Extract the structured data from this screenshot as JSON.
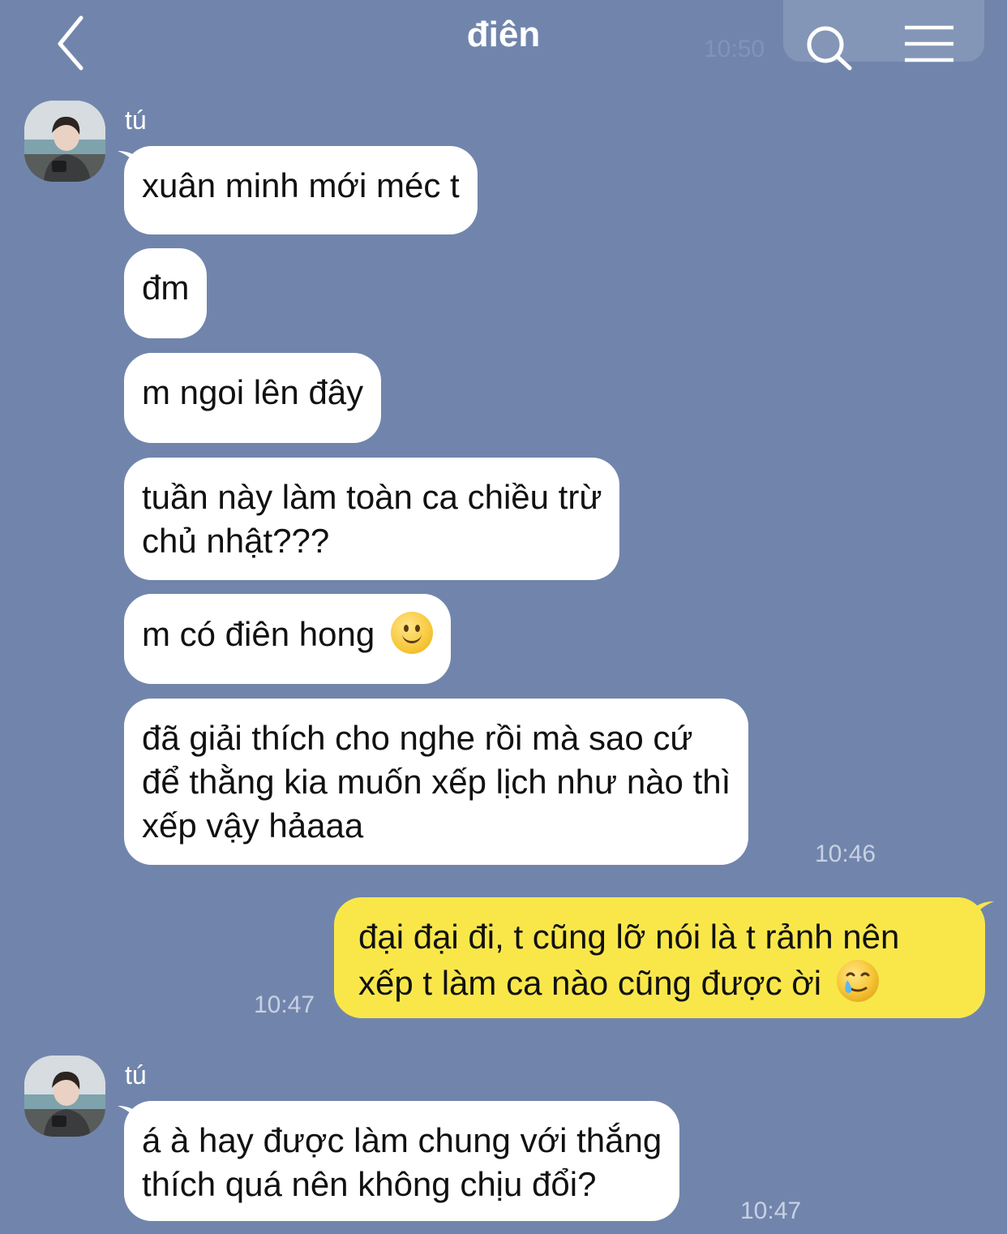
{
  "header": {
    "title": "điên",
    "ghost_time": "10:50"
  },
  "messages": [
    {
      "sender": "tú",
      "text": "xuân minh mới méc t"
    },
    {
      "text": "đm"
    },
    {
      "text": "m ngoi lên đây"
    },
    {
      "line1": "tuần này làm toàn ca chiều trừ",
      "line2": "chủ nhật???"
    },
    {
      "text": "m có điên hong",
      "emoji": "slightly-smiling-face"
    },
    {
      "line1": "đã giải thích cho nghe rồi mà sao cứ",
      "line2": "để thằng kia muốn xếp lịch như nào thì",
      "line3": "xếp vậy hảaaa",
      "time": "10:46"
    },
    {
      "line1": "đại đại đi, t cũng lỡ nói là t rảnh nên",
      "line2": "xếp t làm ca nào cũng được ời",
      "emoji": "smiling-face-with-tear",
      "time": "10:47"
    },
    {
      "sender": "tú",
      "line1": "á à hay được làm chung với thắng",
      "line2": "thích quá nên không chịu đổi?",
      "time": "10:47"
    }
  ],
  "colors": {
    "background": "#7185ac",
    "incoming_bubble": "#ffffff",
    "outgoing_bubble": "#f9e74a",
    "timestamp": "#c7d1e3"
  },
  "icons": {
    "back": "chevron-left-icon",
    "search": "search-icon",
    "menu": "menu-icon"
  }
}
